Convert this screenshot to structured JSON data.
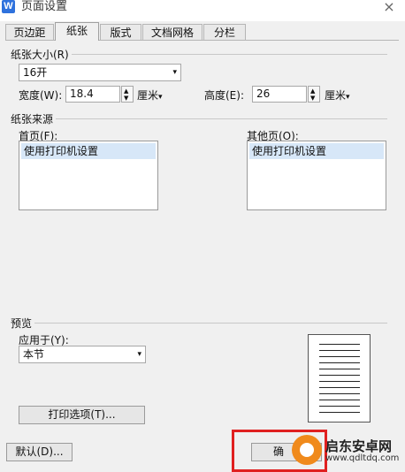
{
  "window": {
    "title": "页面设置",
    "close_glyph": "×",
    "app_icon_letter": "W"
  },
  "tabs": [
    "页边距",
    "纸张",
    "版式",
    "文档网格",
    "分栏"
  ],
  "paper_size": {
    "group_title": "纸张大小(R)",
    "size_value": "16开",
    "width_label": "宽度(W):",
    "width_value": "18.4",
    "width_unit": "厘米",
    "height_label": "高度(E):",
    "height_value": "26",
    "height_unit": "厘米"
  },
  "paper_source": {
    "group_title": "纸张来源",
    "first_page_label": "首页(F):",
    "first_page_item": "使用打印机设置",
    "other_pages_label": "其他页(O):",
    "other_pages_item": "使用打印机设置"
  },
  "preview": {
    "group_title": "预览",
    "apply_to_label": "应用于(Y):",
    "apply_to_value": "本节",
    "print_options_button": "打印选项(T)..."
  },
  "footer": {
    "default_button": "默认(D)...",
    "ok_button_partial": "确"
  },
  "watermark": {
    "brand": "启东安卓网",
    "url": "www.qdltdq.com"
  },
  "icons": {
    "arrow_down": "▾",
    "spin_up": "▲",
    "spin_down": "▼"
  },
  "colors": {
    "dialog_bg": "#f0f0f0",
    "selection": "#d7e7f8",
    "highlight_box": "#e02020",
    "app_icon": "#2f72dd"
  }
}
